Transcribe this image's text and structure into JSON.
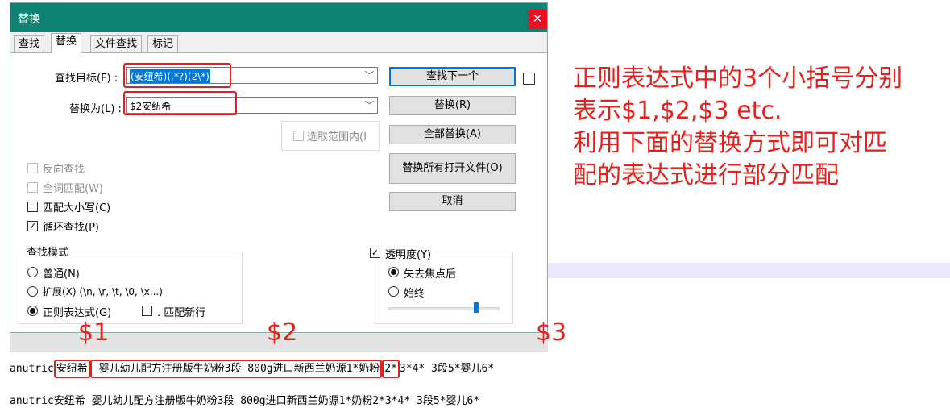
{
  "dialog": {
    "title": "替换",
    "close_glyph": "✕",
    "tabs": [
      "查找",
      "替换",
      "文件查找",
      "标记"
    ],
    "find_label": "查找目标(F) :",
    "find_value": "(安纽希)(.*?)(2\\*)",
    "replace_label": "替换为(L) :",
    "replace_value": "$2安纽希",
    "in_selection_label": "选取范围内(I",
    "buttons": {
      "find_next": "查找下一个",
      "replace": "替换(R)",
      "replace_all": "全部替换(A)",
      "replace_all_open": "替换所有打开文件(O)",
      "cancel": "取消"
    },
    "options": {
      "backward": "反向查找",
      "whole_word": "全词匹配(W)",
      "match_case": "匹配大小写(C)",
      "wrap": "循环查找(P)"
    },
    "search_mode": {
      "title": "查找模式",
      "normal": "普通(N)",
      "extended": "扩展(X) (\\n, \\r, \\t, \\0, \\x...)",
      "regex": "正则表达式(G)",
      "dot_newline": ". 匹配新行"
    },
    "transparency": {
      "label": "透明度(Y)",
      "on_lose_focus": "失去焦点后",
      "always": "始终",
      "slider_level": 0.8
    },
    "check_glyph": "✓"
  },
  "annotation": {
    "line1": "正则表达式中的3个小括号分别",
    "line2": "表示$1,$2,$3 etc.",
    "line3": "利用下面的替换方式即可对匹",
    "line4": "配的表达式进行部分匹配",
    "g1": "$1",
    "g2": "$2",
    "g3": "$3"
  },
  "editor": {
    "line1": {
      "prefix": "anutric",
      "group1": "安纽希",
      "group2": " 婴儿幼儿配方注册版牛奶粉3段 800g进口新西兰奶源1*奶粉",
      "group3": "2*",
      "suffix": "3*4* 3段5*婴儿6*"
    },
    "line2": "anutric安纽希 婴儿幼儿配方注册版牛奶粉3段 800g进口新西兰奶源1*奶粉2*3*4* 3段5*婴儿6*"
  }
}
